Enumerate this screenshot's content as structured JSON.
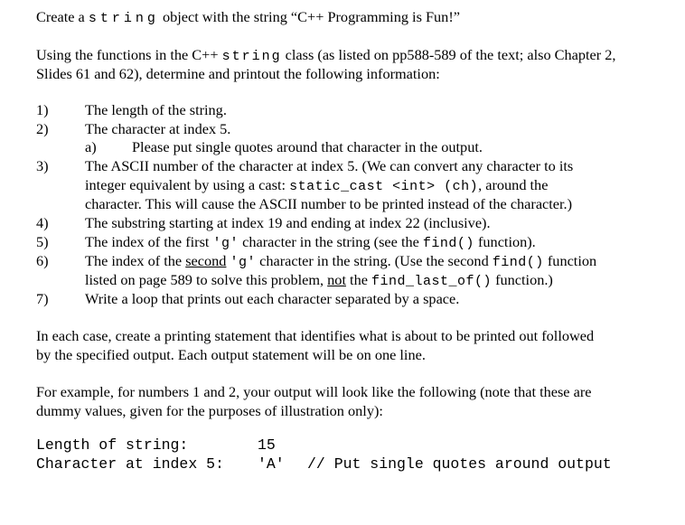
{
  "intro": {
    "a": "Create a ",
    "code": "string",
    "b": " object with the string “C++ Programming is Fun!”"
  },
  "para1": {
    "a": "Using the functions in the C++ ",
    "code": "string",
    "b": " class (as listed on pp588-589 of the text; also Chapter 2,",
    "line2": "Slides 61 and 62), determine and printout the following information:"
  },
  "items": [
    {
      "num": "1)",
      "text": "The length of the string."
    },
    {
      "num": "2)",
      "text": "The character at index 5."
    },
    {
      "num": "a)",
      "text": "Please put single quotes around that character in the output."
    },
    {
      "num": "3)",
      "l1": "The ASCII number of the character at index 5.  (We can convert any character to its",
      "l2a": "integer equivalent by using a cast: ",
      "l2code": "static_cast <int> (ch)",
      "l2b": ", around the",
      "l3": "character.  This will cause the ASCII number to be printed instead of the character.)"
    },
    {
      "num": "4)",
      "text": "The substring starting at index 19 and ending at index 22 (inclusive)."
    },
    {
      "num": "5)",
      "a": "The index of the first ",
      "code1": "'g'",
      "b": " character in the string (see the ",
      "code2": "find()",
      "c": " function)."
    },
    {
      "num": "6)",
      "a": "The index of the ",
      "u": "second",
      "b": " ",
      "code1": "'g'",
      "c": " character in the string.  (Use the second ",
      "code2": "find()",
      "d": " function",
      "l2a": "listed on page 589 to solve this problem, ",
      "l2u": "not",
      "l2b": " the ",
      "l2code": "find_last_of()",
      "l2c": " function.)"
    },
    {
      "num": "7)",
      "text": "Write a loop that prints out each character separated by a space."
    }
  ],
  "para2": {
    "l1": "In each case, create a printing statement that identifies what is about to be printed out followed",
    "l2": "by the specified output.  Each output statement will be on one line."
  },
  "para3": {
    "l1": "For example, for numbers 1 and 2, your output will look like the following (note that these are",
    "l2": "dummy values, given for the purposes of illustration only):"
  },
  "example": [
    {
      "label": "Length of string:",
      "value": "15",
      "comment": ""
    },
    {
      "label": "Character at index 5:",
      "value": "'A'",
      "comment": "// Put single quotes around output"
    }
  ]
}
